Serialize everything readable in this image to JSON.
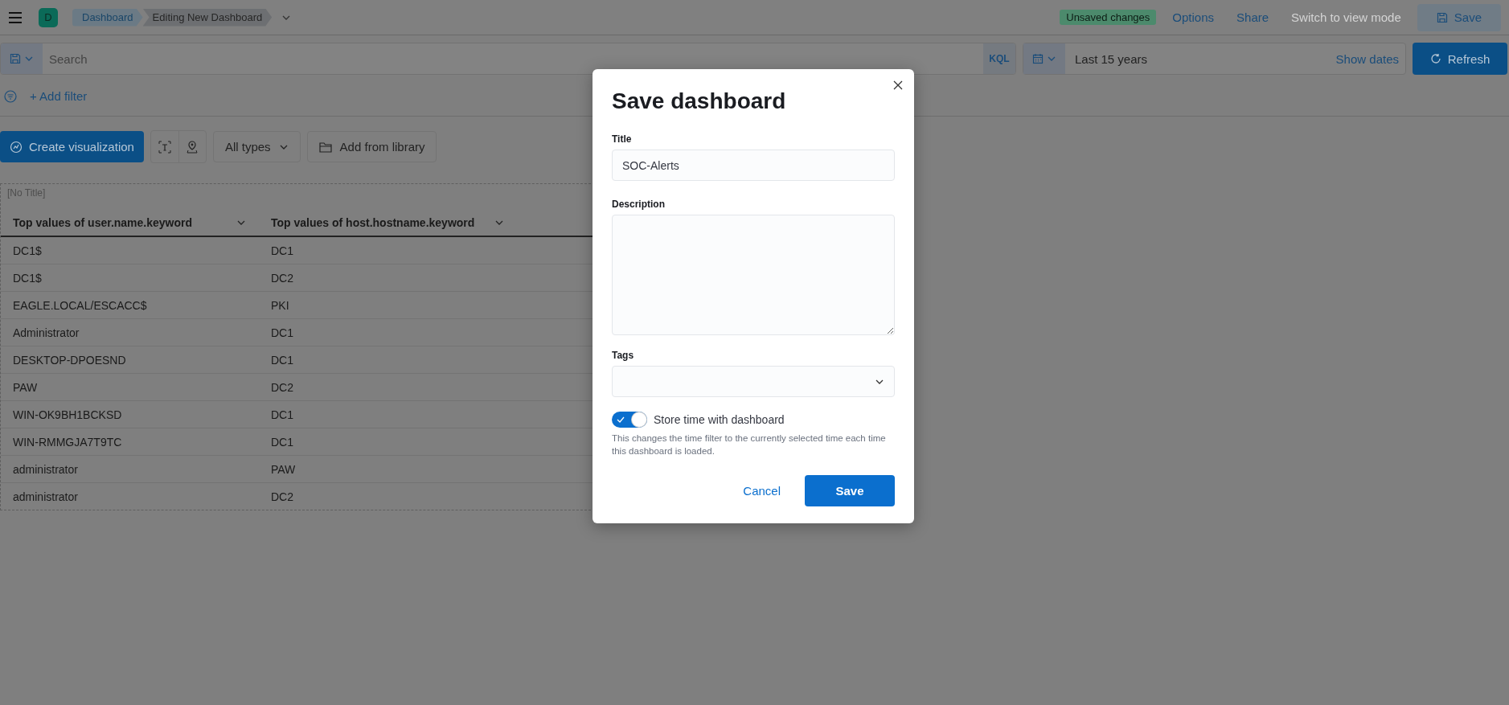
{
  "header": {
    "avatar_letter": "D",
    "breadcrumbs": [
      {
        "label": "Dashboard",
        "selected": false
      },
      {
        "label": "Editing New Dashboard",
        "selected": true
      }
    ],
    "badge": "Unsaved changes",
    "actions": [
      {
        "label": "Options",
        "disabled": false
      },
      {
        "label": "Share",
        "disabled": false
      },
      {
        "label": "Switch to view mode",
        "disabled": true
      }
    ],
    "save_button": "Save"
  },
  "query_bar": {
    "search_placeholder": "Search",
    "language": "KQL",
    "time_range": "Last 15 years",
    "show_dates": "Show dates",
    "refresh_button": "Refresh"
  },
  "filter_bar": {
    "add_filter": "+ Add filter"
  },
  "toolbar": {
    "create_button": "Create visualization",
    "types_dropdown": "All types",
    "library_button": "Add from library"
  },
  "panel": {
    "title": "[No Title]",
    "columns": [
      "Top values of user.name.keyword",
      "Top values of host.hostname.keyword"
    ],
    "rows": [
      [
        "DC1$",
        "DC1"
      ],
      [
        "DC1$",
        "DC2"
      ],
      [
        "EAGLE.LOCAL/ESCACC$",
        "PKI"
      ],
      [
        "Administrator",
        "DC1"
      ],
      [
        "DESKTOP-DPOESND",
        "DC1"
      ],
      [
        "PAW",
        "DC2"
      ],
      [
        "WIN-OK9BH1BCKSD",
        "DC1"
      ],
      [
        "WIN-RMMGJA7T9TC",
        "DC1"
      ],
      [
        "administrator",
        "PAW"
      ],
      [
        "administrator",
        "DC2"
      ]
    ]
  },
  "modal": {
    "title": "Save dashboard",
    "title_label": "Title",
    "title_value": "SOC-Alerts",
    "description_label": "Description",
    "tags_label": "Tags",
    "toggle": {
      "label": "Store time with dashboard",
      "on": true,
      "help": "This changes the time filter to the currently selected time each time this dashboard is loaded."
    },
    "cancel_button": "Cancel",
    "save_button": "Save"
  }
}
